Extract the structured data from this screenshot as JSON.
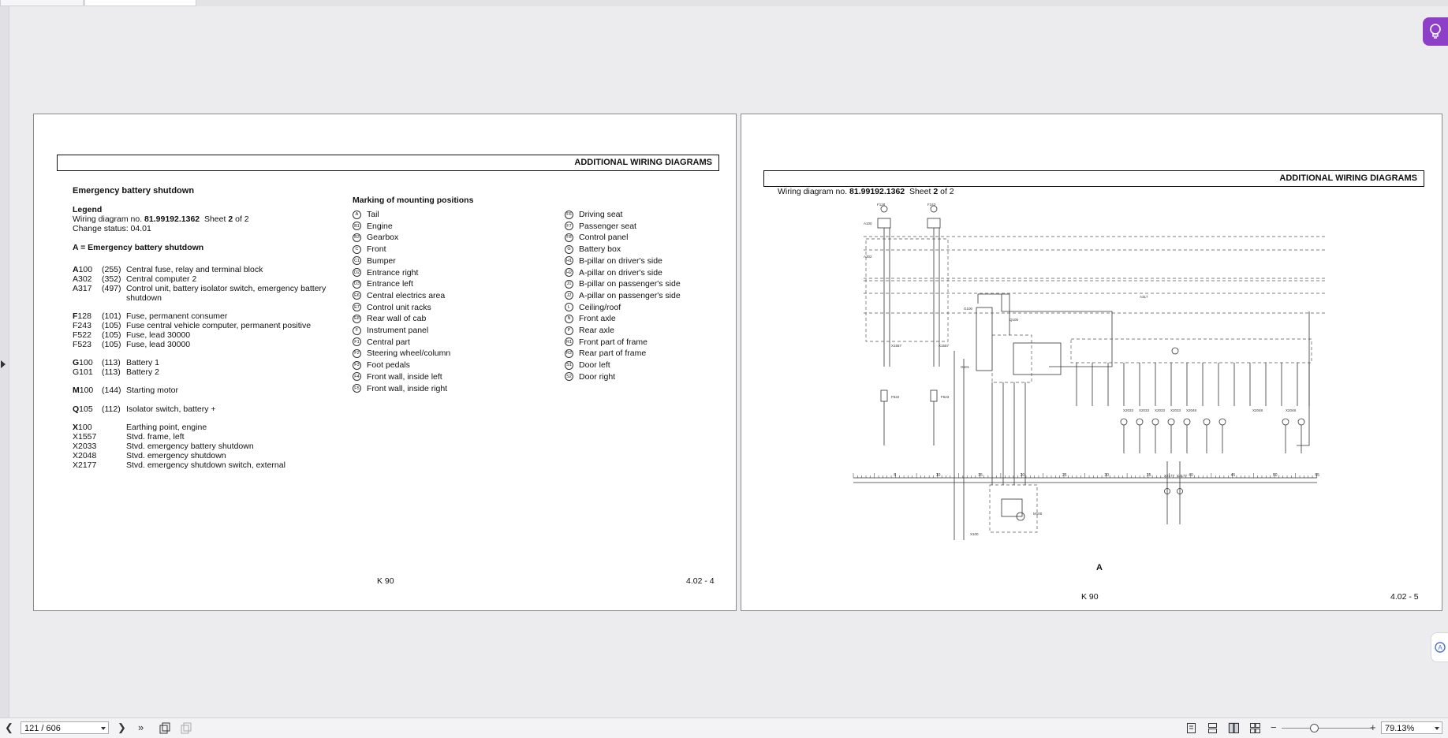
{
  "viewer": {
    "page_indicator": "121 / 606",
    "zoom": "79.13%"
  },
  "left_page": {
    "header": "ADDITIONAL WIRING DIAGRAMS",
    "title": "Emergency battery shutdown",
    "legend_heading": "Legend",
    "wiring_prefix": "Wiring diagram no.",
    "wiring_no": "81.99192.1362",
    "sheet_label": "Sheet",
    "sheet_no": "2",
    "sheet_of": "of 2",
    "change_status": "Change status: 04.01",
    "a_heading": "A = Emergency battery shutdown",
    "components": [
      {
        "letter": "A",
        "rest": "100",
        "num": "(255)",
        "desc": "Central fuse, relay and terminal block"
      },
      {
        "letter": "",
        "rest": "A302",
        "num": "(352)",
        "desc": "Central computer 2"
      },
      {
        "letter": "",
        "rest": "A317",
        "num": "(497)",
        "desc": "Control unit, battery isolator switch, emergency battery"
      },
      {
        "letter": "",
        "rest": "",
        "num": "",
        "desc": "shutdown"
      },
      {
        "letter": "F",
        "rest": "128",
        "num": "(101)",
        "desc": "Fuse, permanent consumer"
      },
      {
        "letter": "",
        "rest": "F243",
        "num": "(105)",
        "desc": "Fuse central vehicle computer, permanent positive"
      },
      {
        "letter": "",
        "rest": "F522",
        "num": "(105)",
        "desc": "Fuse, lead 30000"
      },
      {
        "letter": "",
        "rest": "F523",
        "num": "(105)",
        "desc": "Fuse, lead 30000"
      },
      {
        "letter": "G",
        "rest": "100",
        "num": "(113)",
        "desc": "Battery 1"
      },
      {
        "letter": "",
        "rest": "G101",
        "num": "(113)",
        "desc": "Battery 2"
      },
      {
        "letter": "M",
        "rest": "100",
        "num": "(144)",
        "desc": "Starting motor"
      },
      {
        "letter": "Q",
        "rest": "105",
        "num": "(112)",
        "desc": "Isolator switch, battery +"
      },
      {
        "letter": "X",
        "rest": "100",
        "num": "",
        "desc": "Earthing point, engine"
      },
      {
        "letter": "",
        "rest": "X1557",
        "num": "",
        "desc": "Stvd. frame, left"
      },
      {
        "letter": "",
        "rest": "X2033",
        "num": "",
        "desc": "Stvd. emergency battery shutdown"
      },
      {
        "letter": "",
        "rest": "X2048",
        "num": "",
        "desc": "Stvd. emergency shutdown"
      },
      {
        "letter": "",
        "rest": "X2177",
        "num": "",
        "desc": "Stvd. emergency shutdown switch, external"
      }
    ],
    "marking_heading": "Marking of mounting positions",
    "marks_col1": [
      {
        "code": "A",
        "label": "Tail"
      },
      {
        "code": "B1",
        "label": "Engine"
      },
      {
        "code": "B3",
        "label": "Gearbox"
      },
      {
        "code": "C",
        "label": "Front"
      },
      {
        "code": "C1",
        "label": "Bumper"
      },
      {
        "code": "D2",
        "label": "Entrance right"
      },
      {
        "code": "D3",
        "label": "Entrance left"
      },
      {
        "code": "E6",
        "label": "Central electrics area"
      },
      {
        "code": "E7",
        "label": "Control unit racks"
      },
      {
        "code": "E8",
        "label": "Rear wall of cab"
      },
      {
        "code": "F",
        "label": "Instrument panel"
      },
      {
        "code": "F1",
        "label": "Central part"
      },
      {
        "code": "F2",
        "label": "Steering wheel/column"
      },
      {
        "code": "F3",
        "label": "Foot pedals"
      },
      {
        "code": "F4",
        "label": "Front wall, inside left"
      },
      {
        "code": "F5",
        "label": "Front wall, inside right"
      }
    ],
    "marks_col2": [
      {
        "code": "F6",
        "label": "Driving seat"
      },
      {
        "code": "F7",
        "label": "Passenger seat"
      },
      {
        "code": "F8",
        "label": "Control panel"
      },
      {
        "code": "G",
        "label": "Battery box"
      },
      {
        "code": "H1",
        "label": "B-pillar on driver's side"
      },
      {
        "code": "H2",
        "label": "A-pillar on driver's side"
      },
      {
        "code": "J1",
        "label": "B-pillar on passenger's side"
      },
      {
        "code": "J2",
        "label": "A-pillar on passenger's side"
      },
      {
        "code": "L",
        "label": "Ceiling/roof"
      },
      {
        "code": "N",
        "label": "Front axle"
      },
      {
        "code": "P",
        "label": "Rear axle"
      },
      {
        "code": "R1",
        "label": "Front part of frame"
      },
      {
        "code": "R2",
        "label": "Rear part of frame"
      },
      {
        "code": "S1",
        "label": "Door left"
      },
      {
        "code": "S2",
        "label": "Door right"
      }
    ],
    "footer_model": "K 90",
    "footer_page": "4.02 - 4"
  },
  "right_page": {
    "header": "ADDITIONAL WIRING DIAGRAMS",
    "wiring_prefix": "Wiring diagram no.",
    "wiring_no": "81.99192.1362",
    "sheet_label": "Sheet",
    "sheet_no": "2",
    "sheet_of": "of 2",
    "diagram": {
      "component_labels": [
        "F128",
        "F243",
        "A100",
        "A302",
        "A317",
        "X1557",
        "X1557",
        "F522",
        "F523",
        "G100",
        "G101",
        "Q105",
        "M100",
        "X100",
        "X2033",
        "X2033",
        "X2033",
        "X2033",
        "X2048",
        "X2048",
        "X2048",
        "X2177",
        "X2177"
      ],
      "scale_numbers": [
        "5",
        "10",
        "15",
        "20",
        "25",
        "30",
        "35",
        "40",
        "45",
        "50",
        "55"
      ],
      "section_letter": "A"
    },
    "footer_model": "K 90",
    "footer_page": "4.02 - 5"
  }
}
